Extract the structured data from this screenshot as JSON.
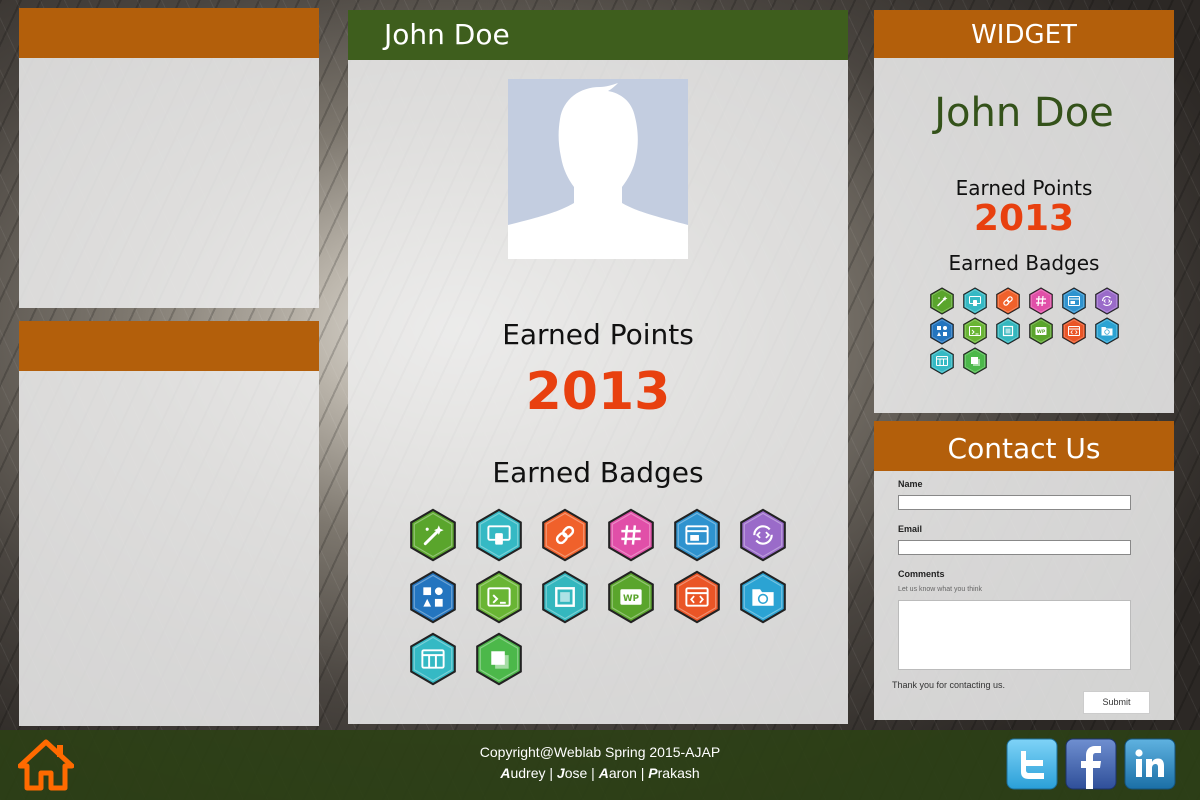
{
  "profile": {
    "name": "John Doe",
    "earned_points_label": "Earned Points",
    "points": "2013",
    "earned_badges_label": "Earned Badges"
  },
  "widget": {
    "title": "WIDGET",
    "name": "John Doe",
    "earned_points_label": "Earned Points",
    "points": "2013",
    "earned_badges_label": "Earned Badges"
  },
  "badges": [
    {
      "icon": "magic-wand-icon",
      "color": "#5aa52c"
    },
    {
      "icon": "responsive-devices-icon",
      "color": "#35b9c4"
    },
    {
      "icon": "chain-link-icon",
      "color": "#f0612b"
    },
    {
      "icon": "hashtag-icon",
      "color": "#e14fa8"
    },
    {
      "icon": "browser-window-icon",
      "color": "#2f93cf"
    },
    {
      "icon": "refresh-code-icon",
      "color": "#9a6bc9"
    },
    {
      "icon": "shapes-icon",
      "color": "#2475bf"
    },
    {
      "icon": "terminal-window-icon",
      "color": "#69b534"
    },
    {
      "icon": "square-layer-icon",
      "color": "#34b7be"
    },
    {
      "icon": "wordpress-icon",
      "color": "#5aa52c"
    },
    {
      "icon": "code-window-icon",
      "color": "#ea5526"
    },
    {
      "icon": "folder-wp-icon",
      "color": "#2ba3d3"
    },
    {
      "icon": "layout-grid-icon",
      "color": "#35b9c4"
    },
    {
      "icon": "stacked-layers-icon",
      "color": "#4cb84a"
    }
  ],
  "contact": {
    "title": "Contact Us",
    "name_label": "Name",
    "name_value": "",
    "email_label": "Email",
    "email_value": "",
    "comments_label": "Comments",
    "comments_hint": "Let us know what you think",
    "comments_value": "",
    "thanks": "Thank you for contacting us.",
    "submit_label": "Submit"
  },
  "footer": {
    "copyright": "Copyright@Weblab Spring 2015-AJAP",
    "credits": [
      {
        "initial": "A",
        "rest": "udrey"
      },
      {
        "initial": "J",
        "rest": "ose"
      },
      {
        "initial": "A",
        "rest": "aron"
      },
      {
        "initial": "P",
        "rest": "rakash"
      }
    ],
    "social": [
      "twitter-icon",
      "facebook-icon",
      "linkedin-icon"
    ]
  },
  "colors": {
    "orange": "#b35f0b",
    "green": "#3e5e1d",
    "points_red": "#e8400f",
    "widget_name_green": "#34521a"
  }
}
